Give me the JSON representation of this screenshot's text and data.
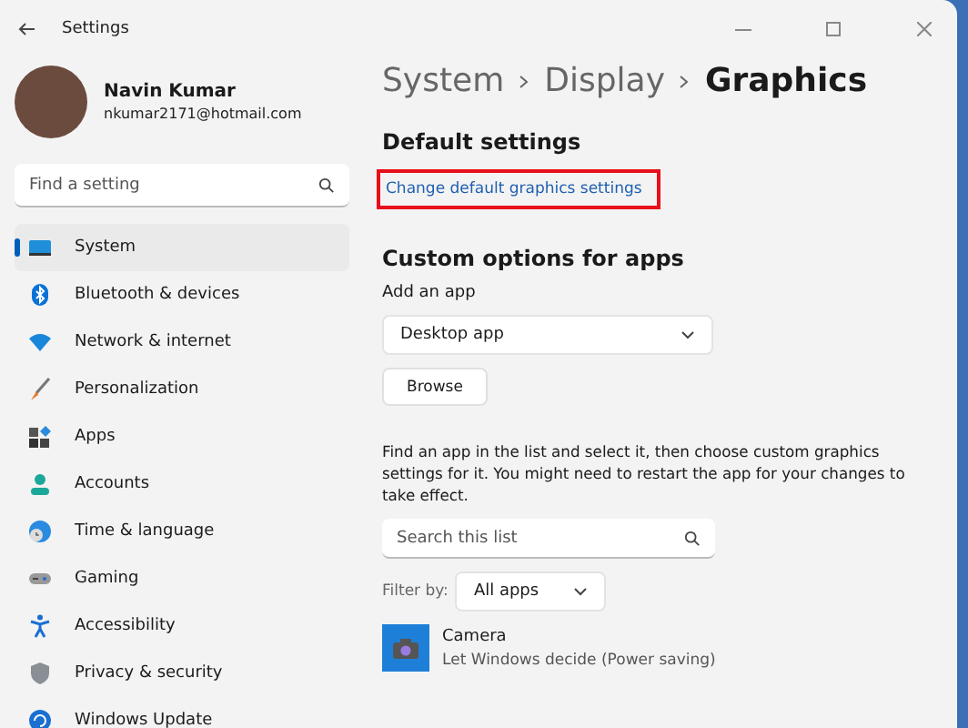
{
  "window": {
    "title": "Settings"
  },
  "user": {
    "name": "Navin Kumar",
    "email": "nkumar2171@hotmail.com"
  },
  "search": {
    "placeholder": "Find a setting"
  },
  "sidebar": {
    "items": [
      {
        "label": "System",
        "kind": "system",
        "selected": true
      },
      {
        "label": "Bluetooth & devices",
        "kind": "bluetooth",
        "selected": false
      },
      {
        "label": "Network & internet",
        "kind": "network",
        "selected": false
      },
      {
        "label": "Personalization",
        "kind": "brush",
        "selected": false
      },
      {
        "label": "Apps",
        "kind": "apps",
        "selected": false
      },
      {
        "label": "Accounts",
        "kind": "accounts",
        "selected": false
      },
      {
        "label": "Time & language",
        "kind": "time",
        "selected": false
      },
      {
        "label": "Gaming",
        "kind": "gaming",
        "selected": false
      },
      {
        "label": "Accessibility",
        "kind": "accessibility",
        "selected": false
      },
      {
        "label": "Privacy & security",
        "kind": "privacy",
        "selected": false
      },
      {
        "label": "Windows Update",
        "kind": "update",
        "selected": false
      }
    ]
  },
  "breadcrumb": [
    "System",
    "Display",
    "Graphics"
  ],
  "default_settings": {
    "heading": "Default settings",
    "link": "Change default graphics settings",
    "highlighted": true
  },
  "custom": {
    "heading": "Custom options for apps",
    "add_label": "Add an app",
    "app_type": "Desktop app",
    "browse": "Browse",
    "description": "Find an app in the list and select it, then choose custom graphics settings for it. You might need to restart the app for your changes to take effect.",
    "list_search": {
      "placeholder": "Search this list"
    },
    "filter_label": "Filter by:",
    "filter_value": "All apps",
    "apps": [
      {
        "name": "Camera",
        "setting": "Let Windows decide (Power saving)"
      }
    ]
  }
}
